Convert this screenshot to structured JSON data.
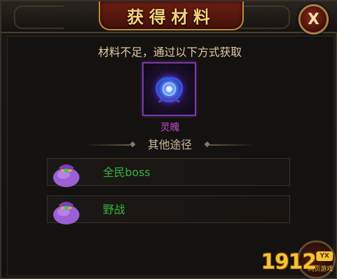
{
  "dialog": {
    "title": "获得材料",
    "close_label": "X",
    "prompt": "材料不足，通过以下方式获取",
    "item": {
      "name": "灵魄",
      "icon": "soul-orb-icon"
    },
    "divider_text": "其他途径",
    "routes": [
      {
        "label": "全民boss",
        "icon": "purple-pouch-icon"
      },
      {
        "label": "野战",
        "icon": "purple-pouch-icon"
      }
    ]
  },
  "watermark": {
    "number": "1912",
    "badge": "YX",
    "subtitle": "网页游戏"
  },
  "colors": {
    "title_text": "#f3d47c",
    "prompt_text": "#e0c9a3",
    "item_name": "#c04ad0",
    "route_text": "#35b43a",
    "item_border": "#7a3aa4"
  }
}
